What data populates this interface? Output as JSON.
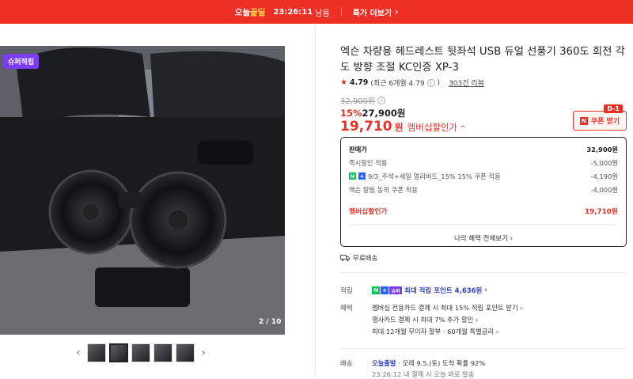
{
  "topbar": {
    "brand_prefix": "오늘",
    "brand_suffix": "끝딜",
    "timer": "23:26:11",
    "remain": "남음",
    "deal_link": "특가 더보기",
    "chevron": "›"
  },
  "gallery": {
    "badge": "슈퍼적립",
    "page_indicator": "2 / 10",
    "prev": "‹",
    "next": "›",
    "thumb_count": 5
  },
  "product": {
    "title": "엑슨 차량용 헤드레스트 뒷좌석 USB 듀얼 선풍기 360도 회전 각도 방향 조절 KC인증 XP-3",
    "rating": "4.79",
    "rating_detail": "(최근 6개월 4.79",
    "rating_detail_end": ")",
    "reviews": "303건 리뷰",
    "original_price": "32,900원",
    "discount_pct": "15%",
    "sale_price": "27,900원",
    "member_price_num": "19,710",
    "member_price_won": "원",
    "member_price_label": "멤버십할인가",
    "member_caret": "^"
  },
  "coupon": {
    "badge": "D-1",
    "label": "쿠폰 받기",
    "icon_letter": "N"
  },
  "breakdown": {
    "rows": [
      {
        "label": "판매가",
        "value": "32,900원"
      },
      {
        "label": "즉시할인 적용",
        "value": "-5,000원"
      },
      {
        "label": "9/3_주석+세일 얼리버드_15% 15% 쿠폰 적용",
        "value": "-4,190원"
      },
      {
        "label": "엑슨 알림 동의 쿠폰 적용",
        "value": "-4,000원"
      }
    ],
    "member_label": "멤버십할인가",
    "member_value": "19,710원",
    "all_benefits": "나의 혜택 전체보기 ›"
  },
  "shipping": {
    "free": "무료배송"
  },
  "points": {
    "label": "적립",
    "text": "최대 적립 포인트",
    "amount": "4,636원",
    "chevron": "›"
  },
  "benefits": {
    "label": "혜택",
    "items": [
      "멤버십 전용카드 결제 시 최대 15% 적립 포인트 받기 ›",
      "행사카드 결제 시 최대 7% 추가 할인 ›",
      "최대 12개월 무이자 할부 · 60개월 특별금리 ›"
    ]
  },
  "delivery": {
    "label": "배송",
    "today": "오늘출발",
    "text": " · 모레 9.5.(토) 도착 확률 92%",
    "sub": "23:26:12 내 결제 시 오늘 바로 발송"
  },
  "colors": {
    "accent": "#ee2f25",
    "point_blue": "#3142c7",
    "npay_green": "#03c75a",
    "badge_purple": "#7a3cf5"
  }
}
